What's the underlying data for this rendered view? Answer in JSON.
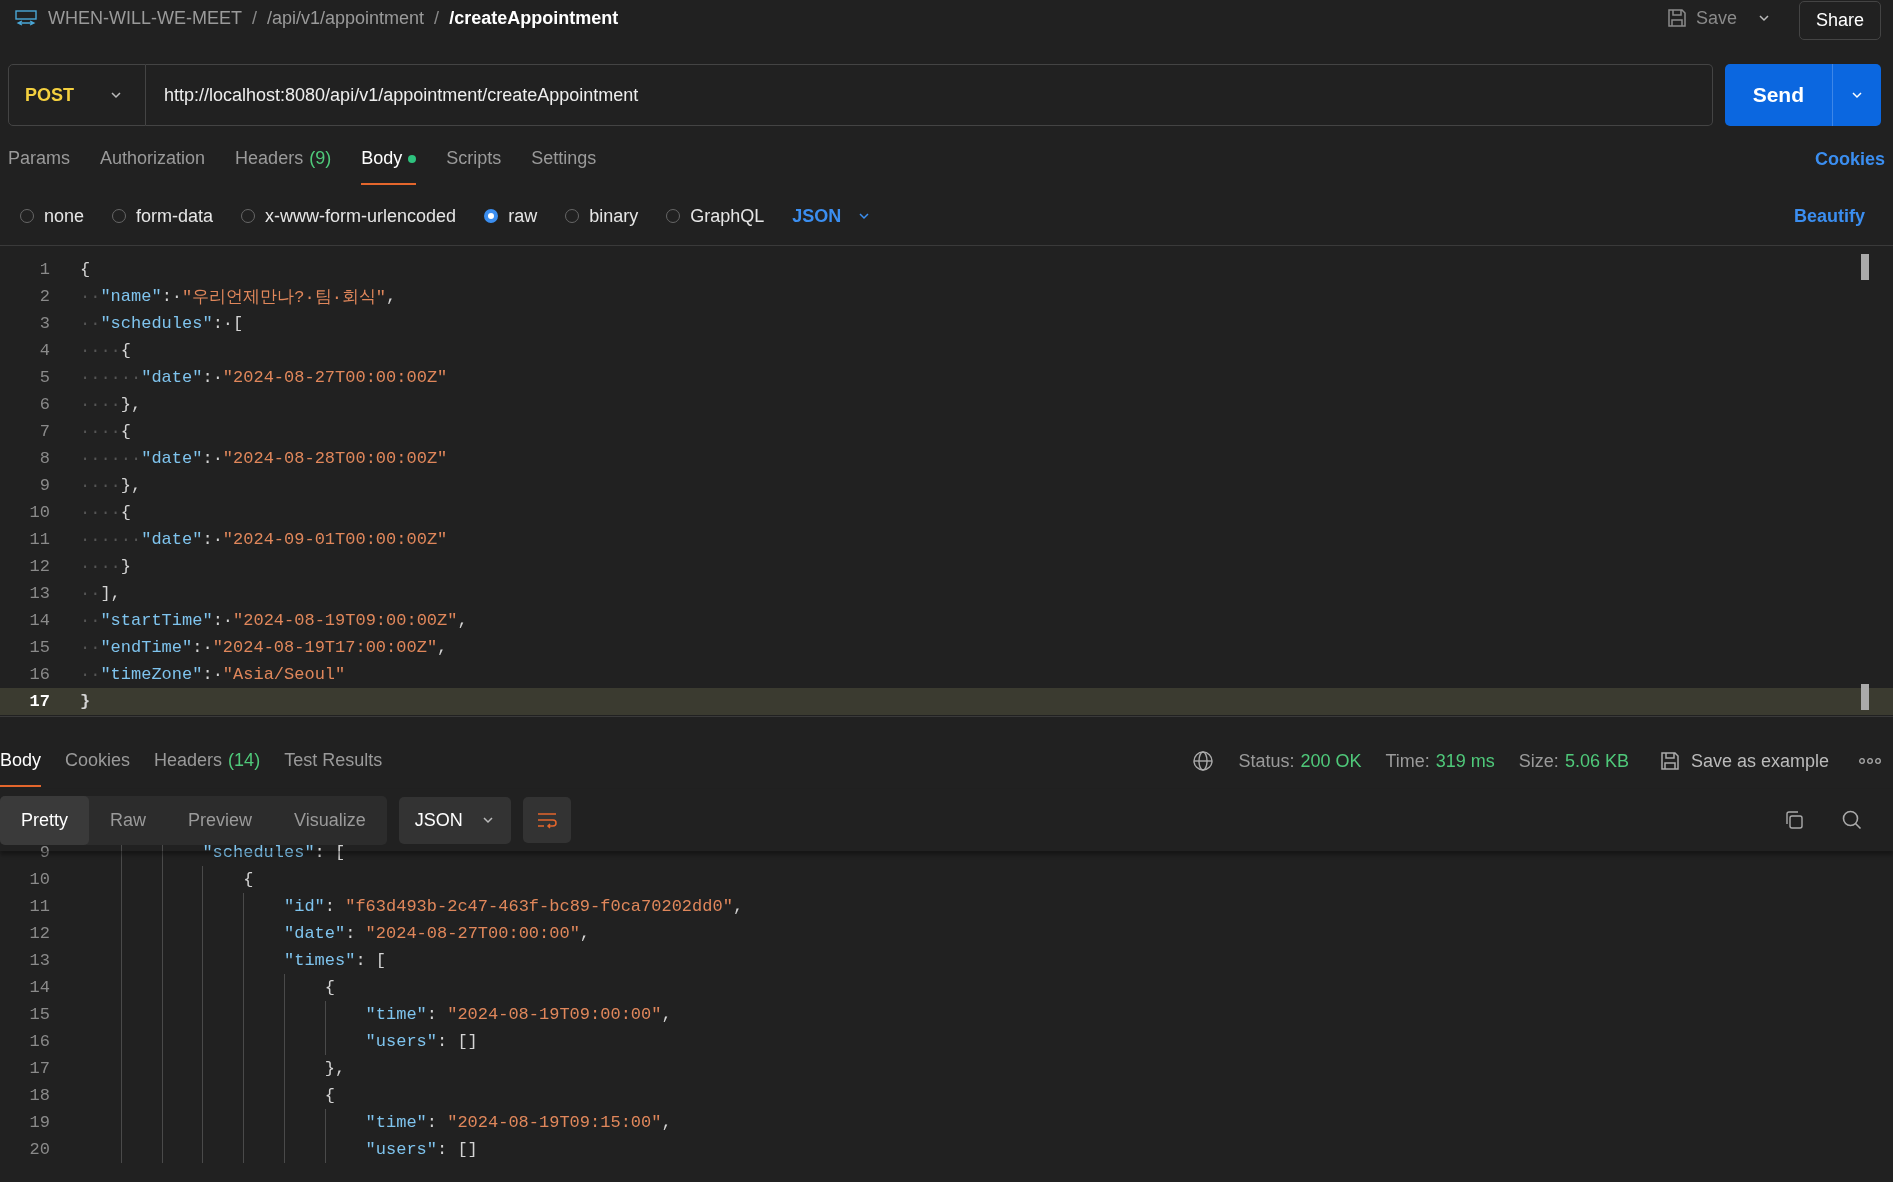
{
  "breadcrumb": [
    {
      "kind": "crumb",
      "text": "WHEN-WILL-WE-MEET"
    },
    {
      "kind": "separator",
      "text": "/"
    },
    {
      "kind": "crumb",
      "text": "/api/v1/appointment"
    },
    {
      "kind": "separator",
      "text": "/"
    },
    {
      "kind": "current",
      "text": "/createAppointment"
    }
  ],
  "header_actions": {
    "save": "Save",
    "share": "Share"
  },
  "request": {
    "method": "POST",
    "url": "http://localhost:8080/api/v1/appointment/createAppointment",
    "send": "Send"
  },
  "request_tabs": [
    {
      "label": "Params",
      "selected": false,
      "has_content": false
    },
    {
      "label": "Authorization",
      "selected": false,
      "has_content": false
    },
    {
      "label": "Headers",
      "count": "(9)",
      "selected": false,
      "has_content": false
    },
    {
      "label": "Body",
      "selected": true,
      "has_content": true
    },
    {
      "label": "Scripts",
      "selected": false,
      "has_content": false
    },
    {
      "label": "Settings",
      "selected": false,
      "has_content": false
    }
  ],
  "cookies": "Cookies",
  "body_types": [
    {
      "label": "none",
      "selected": false
    },
    {
      "label": "form-data",
      "selected": false
    },
    {
      "label": "x-www-form-urlencoded",
      "selected": false
    },
    {
      "label": "raw",
      "selected": true
    },
    {
      "label": "binary",
      "selected": false
    },
    {
      "label": "GraphQL",
      "selected": false
    }
  ],
  "body_format": "JSON",
  "beautify": "Beautify",
  "editor_lines": [
    {
      "number": "1",
      "current": false,
      "tokens": [
        {
          "kind": "p",
          "text": "{"
        }
      ]
    },
    {
      "number": "2",
      "current": false,
      "tokens": [
        {
          "kind": "ws",
          "text": "··"
        },
        {
          "kind": "k",
          "text": "\"name\""
        },
        {
          "kind": "p",
          "text": ":·"
        },
        {
          "kind": "s",
          "text": "\"우리언제만나?·팀·회식\""
        },
        {
          "kind": "p",
          "text": ","
        }
      ]
    },
    {
      "number": "3",
      "current": false,
      "tokens": [
        {
          "kind": "ws",
          "text": "··"
        },
        {
          "kind": "k",
          "text": "\"schedules\""
        },
        {
          "kind": "p",
          "text": ":·["
        }
      ]
    },
    {
      "number": "4",
      "current": false,
      "tokens": [
        {
          "kind": "ws",
          "text": "····"
        },
        {
          "kind": "p",
          "text": "{"
        }
      ]
    },
    {
      "number": "5",
      "current": false,
      "tokens": [
        {
          "kind": "ws",
          "text": "······"
        },
        {
          "kind": "k",
          "text": "\"date\""
        },
        {
          "kind": "p",
          "text": ":·"
        },
        {
          "kind": "s",
          "text": "\"2024-08-27T00:00:00Z\""
        }
      ]
    },
    {
      "number": "6",
      "current": false,
      "tokens": [
        {
          "kind": "ws",
          "text": "····"
        },
        {
          "kind": "p",
          "text": "},"
        }
      ]
    },
    {
      "number": "7",
      "current": false,
      "tokens": [
        {
          "kind": "ws",
          "text": "····"
        },
        {
          "kind": "p",
          "text": "{"
        }
      ]
    },
    {
      "number": "8",
      "current": false,
      "tokens": [
        {
          "kind": "ws",
          "text": "······"
        },
        {
          "kind": "k",
          "text": "\"date\""
        },
        {
          "kind": "p",
          "text": ":·"
        },
        {
          "kind": "s",
          "text": "\"2024-08-28T00:00:00Z\""
        }
      ]
    },
    {
      "number": "9",
      "current": false,
      "tokens": [
        {
          "kind": "ws",
          "text": "····"
        },
        {
          "kind": "p",
          "text": "},"
        }
      ]
    },
    {
      "number": "10",
      "current": false,
      "tokens": [
        {
          "kind": "ws",
          "text": "····"
        },
        {
          "kind": "p",
          "text": "{"
        }
      ]
    },
    {
      "number": "11",
      "current": false,
      "tokens": [
        {
          "kind": "ws",
          "text": "······"
        },
        {
          "kind": "k",
          "text": "\"date\""
        },
        {
          "kind": "p",
          "text": ":·"
        },
        {
          "kind": "s",
          "text": "\"2024-09-01T00:00:00Z\""
        }
      ]
    },
    {
      "number": "12",
      "current": false,
      "tokens": [
        {
          "kind": "ws",
          "text": "····"
        },
        {
          "kind": "p",
          "text": "}"
        }
      ]
    },
    {
      "number": "13",
      "current": false,
      "tokens": [
        {
          "kind": "ws",
          "text": "··"
        },
        {
          "kind": "p",
          "text": "],"
        }
      ]
    },
    {
      "number": "14",
      "current": false,
      "tokens": [
        {
          "kind": "ws",
          "text": "··"
        },
        {
          "kind": "k",
          "text": "\"startTime\""
        },
        {
          "kind": "p",
          "text": ":·"
        },
        {
          "kind": "s",
          "text": "\"2024-08-19T09:00:00Z\""
        },
        {
          "kind": "p",
          "text": ","
        }
      ]
    },
    {
      "number": "15",
      "current": false,
      "tokens": [
        {
          "kind": "ws",
          "text": "··"
        },
        {
          "kind": "k",
          "text": "\"endTime\""
        },
        {
          "kind": "p",
          "text": ":·"
        },
        {
          "kind": "s",
          "text": "\"2024-08-19T17:00:00Z\""
        },
        {
          "kind": "p",
          "text": ","
        }
      ]
    },
    {
      "number": "16",
      "current": false,
      "tokens": [
        {
          "kind": "ws",
          "text": "··"
        },
        {
          "kind": "k",
          "text": "\"timeZone\""
        },
        {
          "kind": "p",
          "text": ":·"
        },
        {
          "kind": "s",
          "text": "\"Asia/Seoul\""
        }
      ]
    },
    {
      "number": "17",
      "current": true,
      "tokens": [
        {
          "kind": "p",
          "text": "}"
        }
      ]
    }
  ],
  "response_tabs": [
    {
      "label": "Body",
      "selected": true
    },
    {
      "label": "Cookies",
      "selected": false
    },
    {
      "label": "Headers",
      "count": "(14)",
      "selected": false
    },
    {
      "label": "Test Results",
      "selected": false
    }
  ],
  "response_meta": [
    {
      "label": "Status:",
      "value": "200 OK"
    },
    {
      "label": "Time:",
      "value": "319 ms"
    },
    {
      "label": "Size:",
      "value": "5.06 KB"
    }
  ],
  "save_example": "Save as example",
  "view_modes": [
    {
      "label": "Pretty",
      "selected": true
    },
    {
      "label": "Raw",
      "selected": false
    },
    {
      "label": "Preview",
      "selected": false
    },
    {
      "label": "Visualize",
      "selected": false
    }
  ],
  "response_format": "JSON",
  "response_lines": [
    {
      "number": "9",
      "tokens": [
        {
          "kind": "k",
          "text": "\"schedules\""
        },
        {
          "kind": "p",
          "text": ": ["
        }
      ],
      "children": [
        {
          "number": "10",
          "tokens": [
            {
              "kind": "p",
              "text": "{"
            }
          ],
          "children": [
            {
              "number": "11",
              "tokens": [
                {
                  "kind": "k",
                  "text": "\"id\""
                },
                {
                  "kind": "p",
                  "text": ": "
                },
                {
                  "kind": "s",
                  "text": "\"f63d493b-2c47-463f-bc89-f0ca70202dd0\""
                },
                {
                  "kind": "p",
                  "text": ","
                }
              ]
            },
            {
              "number": "12",
              "tokens": [
                {
                  "kind": "k",
                  "text": "\"date\""
                },
                {
                  "kind": "p",
                  "text": ": "
                },
                {
                  "kind": "s",
                  "text": "\"2024-08-27T00:00:00\""
                },
                {
                  "kind": "p",
                  "text": ","
                }
              ]
            },
            {
              "number": "13",
              "tokens": [
                {
                  "kind": "k",
                  "text": "\"times\""
                },
                {
                  "kind": "p",
                  "text": ": ["
                }
              ],
              "children": [
                {
                  "number": "14",
                  "tokens": [
                    {
                      "kind": "p",
                      "text": "{"
                    }
                  ],
                  "children": [
                    {
                      "number": "15",
                      "tokens": [
                        {
                          "kind": "k",
                          "text": "\"time\""
                        },
                        {
                          "kind": "p",
                          "text": ": "
                        },
                        {
                          "kind": "s",
                          "text": "\"2024-08-19T09:00:00\""
                        },
                        {
                          "kind": "p",
                          "text": ","
                        }
                      ]
                    },
                    {
                      "number": "16",
                      "tokens": [
                        {
                          "kind": "k",
                          "text": "\"users\""
                        },
                        {
                          "kind": "p",
                          "text": ": []"
                        }
                      ]
                    }
                  ]
                },
                {
                  "number": "17",
                  "tokens": [
                    {
                      "kind": "p",
                      "text": "},"
                    }
                  ]
                },
                {
                  "number": "18",
                  "tokens": [
                    {
                      "kind": "p",
                      "text": "{"
                    }
                  ],
                  "children": [
                    {
                      "number": "19",
                      "tokens": [
                        {
                          "kind": "k",
                          "text": "\"time\""
                        },
                        {
                          "kind": "p",
                          "text": ": "
                        },
                        {
                          "kind": "s",
                          "text": "\"2024-08-19T09:15:00\""
                        },
                        {
                          "kind": "p",
                          "text": ","
                        }
                      ]
                    },
                    {
                      "number": "20",
                      "tokens": [
                        {
                          "kind": "k",
                          "text": "\"users\""
                        },
                        {
                          "kind": "p",
                          "text": ": []"
                        }
                      ]
                    }
                  ]
                }
              ]
            }
          ]
        }
      ]
    }
  ]
}
